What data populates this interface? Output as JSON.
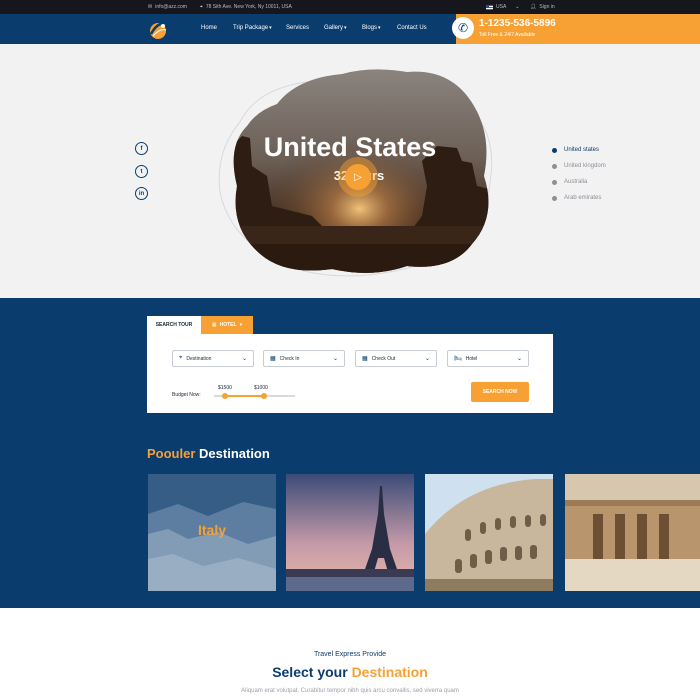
{
  "topbar": {
    "email": "info@azz.com",
    "address": "78 Sith Ave. New York, Ny 10011, USA",
    "language": "USA",
    "signin": "Sign in"
  },
  "nav": {
    "items": [
      {
        "label": "Home",
        "has_caret": false
      },
      {
        "label": "Trip Package",
        "has_caret": true
      },
      {
        "label": "Services",
        "has_caret": false
      },
      {
        "label": "Gallery",
        "has_caret": true
      },
      {
        "label": "Blogs",
        "has_caret": true
      },
      {
        "label": "Contact Us",
        "has_caret": false
      }
    ],
    "phone": "1-1235-536-5896",
    "phone_note": "Toll Free & 24/7 Available"
  },
  "hero": {
    "title": "United States",
    "subtitle": "32 tours",
    "social": [
      {
        "name": "facebook",
        "glyph": "f"
      },
      {
        "name": "twitter",
        "glyph": "t"
      },
      {
        "name": "linkedin",
        "glyph": "in"
      }
    ],
    "countries": [
      {
        "label": "United states",
        "active": true
      },
      {
        "label": "United kingdom",
        "active": false
      },
      {
        "label": "Australia",
        "active": false
      },
      {
        "label": "Arab emirates",
        "active": false
      }
    ]
  },
  "search": {
    "tab_search": "SEARCH TOUR",
    "tab_hotel": "HOTEL",
    "fields": [
      {
        "name": "destination",
        "label": "Destination",
        "icon": "location-pin-icon"
      },
      {
        "name": "check-in",
        "label": "Check In",
        "icon": "calendar-icon"
      },
      {
        "name": "check-out",
        "label": "Check Out",
        "icon": "calendar-icon"
      },
      {
        "name": "hotel",
        "label": "Hotel",
        "icon": "bed-icon"
      }
    ],
    "budget_label": "Budget Now:",
    "budget_min": "$1500",
    "budget_max": "$1000",
    "button": "SEARCH NOW"
  },
  "popular": {
    "title_accent": "Poouler",
    "title_rest": "Destination",
    "cards": [
      {
        "name": "italy",
        "label": "Italy"
      },
      {
        "name": "paris",
        "label": ""
      },
      {
        "name": "rome",
        "label": ""
      },
      {
        "name": "egypt",
        "label": ""
      }
    ]
  },
  "select": {
    "kicker": "Travel Express Provide",
    "title_main": "Select your",
    "title_accent": "Destination",
    "text": "Aliquam erat volutpat. Curabitur tempor nibh quis arcu convallis, sed viverra quam"
  },
  "colors": {
    "navy": "#0a3d6e",
    "orange": "#f7a134",
    "dark": "#15171c"
  }
}
